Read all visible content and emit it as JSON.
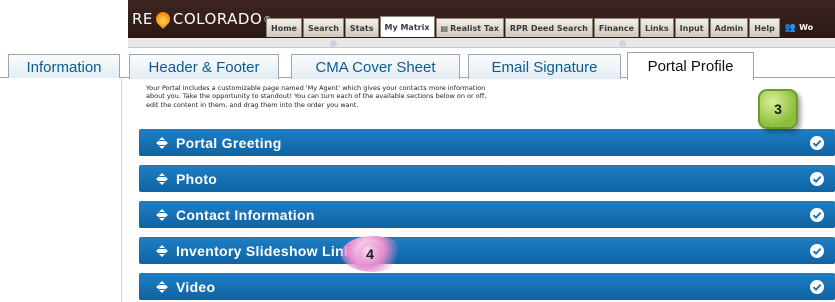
{
  "brand": {
    "logo_text_left": "RE",
    "logo_text_right": "COLORADO"
  },
  "nav": {
    "tabs": [
      {
        "label": "Home"
      },
      {
        "label": "Search"
      },
      {
        "label": "Stats"
      },
      {
        "label": "My Matrix",
        "active": true
      },
      {
        "label": "Realist Tax",
        "icon": "document-icon"
      },
      {
        "label": "RPR Deed Search"
      },
      {
        "label": "Finance"
      },
      {
        "label": "Links"
      },
      {
        "label": "Input"
      },
      {
        "label": "Admin"
      },
      {
        "label": "Help"
      }
    ],
    "user_label": "Wo"
  },
  "settings_tabs": [
    {
      "label": "Information"
    },
    {
      "label": "Header & Footer"
    },
    {
      "label": "CMA Cover Sheet"
    },
    {
      "label": "Email Signature"
    },
    {
      "label": "Portal Profile",
      "active": true
    }
  ],
  "intro": {
    "line1": "Your Portal includes a customizable page named 'My Agent' which gives your contacts more information",
    "line2": "about you. Take the opportunity to standout! You can turn each of the available sections below on or off,",
    "line3": "edit the content in them, and drag them into the order you want."
  },
  "sections": [
    {
      "title": "Portal Greeting",
      "enabled": true
    },
    {
      "title": "Photo",
      "enabled": true
    },
    {
      "title": "Contact Information",
      "enabled": true
    },
    {
      "title": "Inventory Slideshow Links",
      "enabled": true
    },
    {
      "title": "Video",
      "enabled": true
    }
  ],
  "callouts": {
    "step3": "3",
    "step4": "4"
  },
  "colors": {
    "section_blue": "#1a72b8",
    "topbar_brown": "#3d2622",
    "tab_text_blue": "#0b5c8e",
    "callout_green": "#8cbe3a",
    "callout_pink": "#e48ccd"
  }
}
